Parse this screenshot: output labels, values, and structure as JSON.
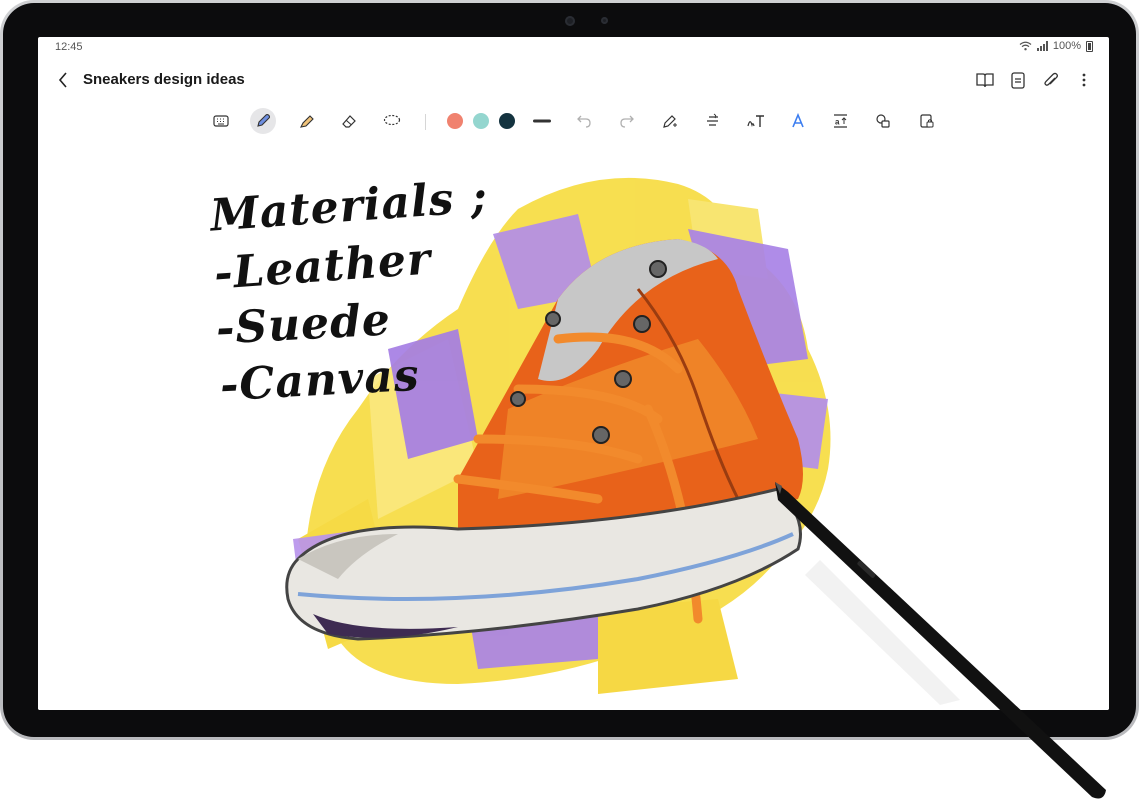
{
  "status_bar": {
    "time": "12:45",
    "battery": "100%"
  },
  "header": {
    "title": "Sneakers design ideas"
  },
  "toolbar": {
    "colors": [
      "#f0826f",
      "#94d6cf",
      "#14333f"
    ]
  },
  "note": {
    "lines": [
      "Materials ;",
      "-Leather",
      "-Suede",
      "-Canvas"
    ]
  }
}
